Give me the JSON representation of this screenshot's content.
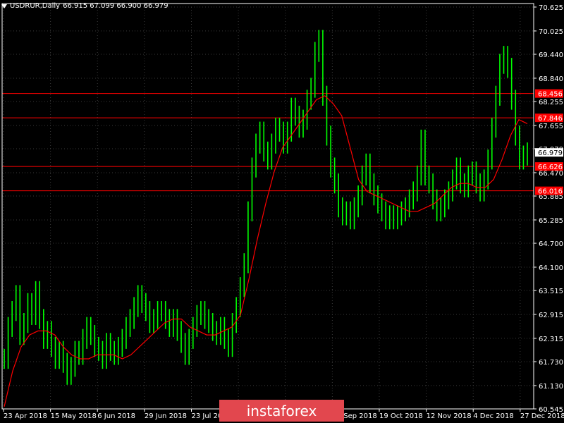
{
  "header": {
    "symbol": "USDRUR,Daily",
    "ohlc": "66.915 67.099 66.900 66.979"
  },
  "watermark": {
    "text": "instaforex"
  },
  "colors": {
    "background": "#000000",
    "grid": "#3a3a3a",
    "candle": "#00ff00",
    "moving_average": "#ff0000",
    "level_line": "#ff0000",
    "level_label_bg": "#ff0000",
    "current_price_bg": "#ffffff"
  },
  "chart_data": {
    "type": "line",
    "title": "",
    "xlabel": "",
    "ylabel": "",
    "ylim": [
      60.545,
      70.625
    ],
    "grid": true,
    "y_ticks": [
      "70.625",
      "70.025",
      "69.440",
      "68.840",
      "68.255",
      "67.655",
      "67.070",
      "66.470",
      "65.885",
      "65.285",
      "64.700",
      "64.100",
      "63.515",
      "62.915",
      "62.315",
      "61.730",
      "61.130",
      "60.545"
    ],
    "x_ticks": [
      "23 Apr 2018",
      "15 May 2018",
      "6 Jun 2018",
      "29 Jun 2018",
      "23 Jul 2018",
      "14 Aug 2018",
      "5 Sep 2018",
      "27 Sep 2018",
      "19 Oct 2018",
      "12 Nov 2018",
      "4 Dec 2018",
      "27 Dec 2018"
    ],
    "levels": [
      {
        "value": 68.456,
        "label": "68.456"
      },
      {
        "value": 67.846,
        "label": "67.846"
      },
      {
        "value": 66.626,
        "label": "66.626"
      },
      {
        "value": 66.016,
        "label": "66.016"
      }
    ],
    "current_price": {
      "value": 66.979,
      "label": "66.979"
    },
    "series": [
      {
        "values": [
          61.8,
          62.6,
          63.0,
          63.4,
          62.4,
          62.7,
          63.2,
          62.9,
          63.5,
          62.8,
          62.3,
          62.5,
          62.1,
          61.8,
          62.0,
          61.7,
          61.4,
          61.6,
          62.0,
          61.9,
          62.3,
          62.6,
          62.4,
          62.1,
          62.0,
          61.8,
          62.2,
          62.0,
          61.9,
          62.1,
          62.3,
          62.6,
          62.8,
          63.1,
          63.4,
          63.2,
          63.0,
          62.7,
          62.8,
          63.0,
          63.0,
          62.8,
          62.6,
          62.8,
          62.5,
          62.2,
          61.9,
          62.3,
          62.6,
          62.9,
          63.0,
          62.8,
          62.7,
          62.5,
          62.4,
          62.6,
          62.3,
          62.1,
          62.7,
          63.1,
          63.6,
          64.2,
          65.5,
          66.6,
          67.2,
          67.5,
          67.0,
          66.8,
          67.2,
          67.6,
          67.5,
          67.2,
          67.5,
          68.1,
          67.9,
          67.6,
          67.8,
          68.3,
          68.6,
          69.5,
          69.8,
          68.4,
          67.4,
          66.6,
          66.2,
          65.6,
          65.4,
          65.5,
          65.3,
          65.6,
          65.9,
          66.4,
          66.7,
          66.2,
          65.9,
          65.7,
          65.5,
          65.3,
          65.4,
          65.3,
          65.4,
          65.5,
          65.6,
          65.8,
          66.0,
          66.4,
          67.3,
          66.4,
          66.2,
          65.8,
          65.5,
          65.6,
          65.8,
          66.0,
          66.3,
          66.6,
          66.2,
          66.1,
          66.4,
          66.5,
          66.2,
          66.0,
          66.3,
          66.8,
          67.6,
          68.4,
          69.2,
          69.4,
          69.1,
          68.3,
          67.4,
          66.8,
          66.9,
          66.979
        ]
      },
      {
        "name": "",
        "values": [
          60.6,
          61.5,
          62.1,
          62.4,
          62.5,
          62.5,
          62.4,
          62.1,
          61.9,
          61.8,
          61.8,
          61.9,
          61.9,
          61.9,
          61.8,
          61.9,
          62.1,
          62.3,
          62.5,
          62.7,
          62.8,
          62.8,
          62.6,
          62.5,
          62.4,
          62.4,
          62.5,
          62.6,
          62.9,
          63.8,
          64.8,
          65.7,
          66.5,
          67.1,
          67.4,
          67.7,
          68.0,
          68.3,
          68.4,
          68.2,
          67.9,
          67.1,
          66.3,
          66.0,
          65.9,
          65.8,
          65.7,
          65.6,
          65.5,
          65.5,
          65.6,
          65.7,
          65.9,
          66.1,
          66.2,
          66.2,
          66.1,
          66.1,
          66.3,
          66.8,
          67.4,
          67.8,
          67.7
        ]
      }
    ]
  }
}
